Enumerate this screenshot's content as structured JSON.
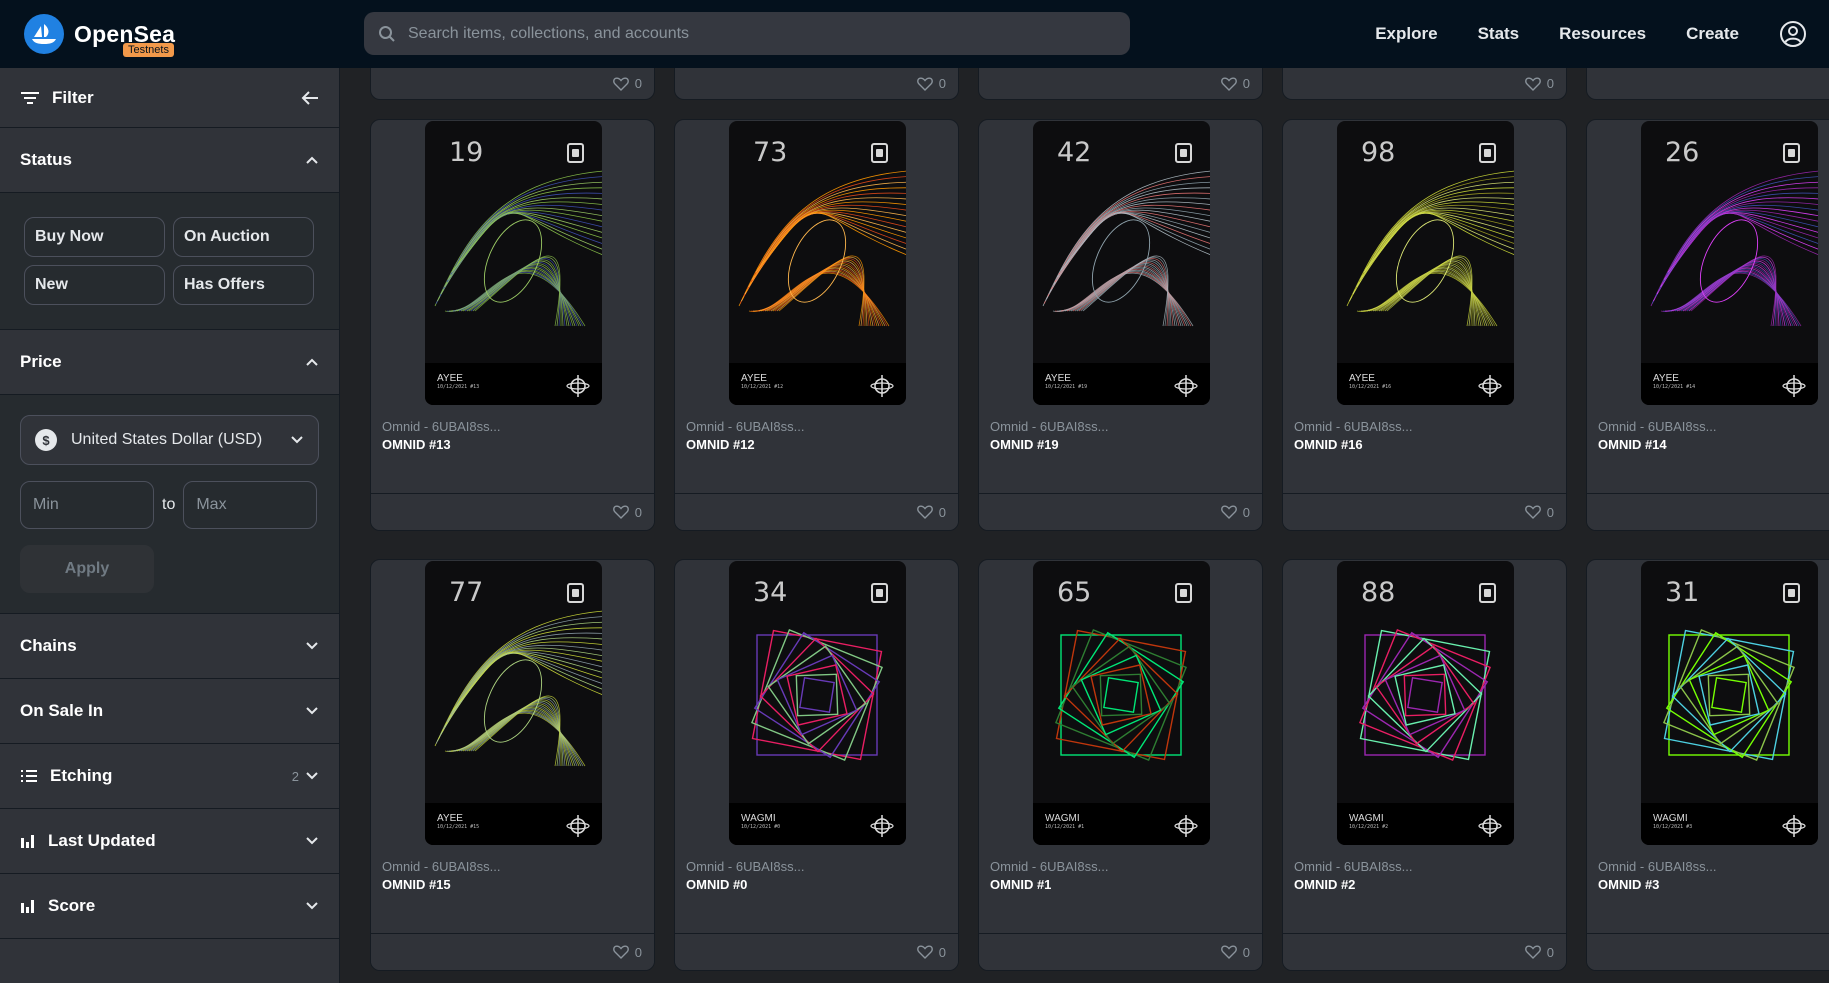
{
  "header": {
    "brand": "OpenSea",
    "env_badge": "Testnets",
    "search_placeholder": "Search items, collections, and accounts",
    "nav": [
      "Explore",
      "Stats",
      "Resources",
      "Create"
    ]
  },
  "sidebar": {
    "filter_label": "Filter",
    "status": {
      "title": "Status",
      "options": [
        "Buy Now",
        "On Auction",
        "New",
        "Has Offers"
      ]
    },
    "price": {
      "title": "Price",
      "currency": "United States Dollar (USD)",
      "currency_symbol": "$",
      "min_placeholder": "Min",
      "max_placeholder": "Max",
      "to": "to",
      "apply": "Apply"
    },
    "sections": [
      {
        "label": "Chains"
      },
      {
        "label": "On Sale In"
      },
      {
        "label": "Etching",
        "count": "2"
      },
      {
        "label": "Last Updated"
      },
      {
        "label": "Score"
      }
    ]
  },
  "top_stubs": {
    "likes": [
      "0",
      "0",
      "0",
      "0"
    ]
  },
  "items": [
    {
      "number": "19",
      "series": "AYEE",
      "date": "10/12/2021 #13",
      "collection": "Omnid - 6UBAI8ss...",
      "name": "OMNID #13",
      "likes": "0",
      "style": "wave",
      "colors": [
        "#8bc34a",
        "#3f51b5",
        "#9ccc65"
      ]
    },
    {
      "number": "73",
      "series": "AYEE",
      "date": "10/12/2021 #12",
      "collection": "Omnid - 6UBAI8ss...",
      "name": "OMNID #12",
      "likes": "0",
      "style": "wave",
      "colors": [
        "#ff9800",
        "#e64a19",
        "#ffb74d"
      ]
    },
    {
      "number": "42",
      "series": "AYEE",
      "date": "10/12/2021 #19",
      "collection": "Omnid - 6UBAI8ss...",
      "name": "OMNID #19",
      "likes": "0",
      "style": "wave",
      "colors": [
        "#b0bec5",
        "#e57373",
        "#90a4ae"
      ]
    },
    {
      "number": "98",
      "series": "AYEE",
      "date": "10/12/2021 #16",
      "collection": "Omnid - 6UBAI8ss...",
      "name": "OMNID #16",
      "likes": "0",
      "style": "wave",
      "colors": [
        "#cddc39",
        "#9e9d24",
        "#dce775"
      ]
    },
    {
      "number": "26",
      "series": "AYEE",
      "date": "10/12/2021 #14",
      "collection": "Omnid - 6UBAI8ss...",
      "name": "OMNID #14",
      "likes": "",
      "style": "wave",
      "colors": [
        "#9c27b0",
        "#3f51b5",
        "#e040fb"
      ]
    },
    {
      "number": "77",
      "series": "AYEE",
      "date": "10/12/2021 #15",
      "collection": "Omnid - 6UBAI8ss...",
      "name": "OMNID #15",
      "likes": "0",
      "style": "wave",
      "colors": [
        "#cddc39",
        "#90a4ae",
        "#aed581"
      ]
    },
    {
      "number": "34",
      "series": "WAGMI",
      "date": "10/12/2021 #0",
      "collection": "Omnid - 6UBAI8ss...",
      "name": "OMNID #0",
      "likes": "0",
      "style": "spiral",
      "colors": [
        "#673ab7",
        "#e91e63",
        "#81c784"
      ]
    },
    {
      "number": "65",
      "series": "WAGMI",
      "date": "10/12/2021 #1",
      "collection": "Omnid - 6UBAI8ss...",
      "name": "OMNID #1",
      "likes": "0",
      "style": "spiral",
      "colors": [
        "#00e676",
        "#bf360c",
        "#2e7d32"
      ]
    },
    {
      "number": "88",
      "series": "WAGMI",
      "date": "10/12/2021 #2",
      "collection": "Omnid - 6UBAI8ss...",
      "name": "OMNID #2",
      "likes": "0",
      "style": "spiral",
      "colors": [
        "#9c27b0",
        "#69f0ae",
        "#e91e63"
      ]
    },
    {
      "number": "31",
      "series": "WAGMI",
      "date": "10/12/2021 #3",
      "collection": "Omnid - 6UBAI8ss...",
      "name": "OMNID #3",
      "likes": "",
      "style": "spiral",
      "colors": [
        "#76ff03",
        "#4dd0e1",
        "#8bc34a"
      ]
    }
  ]
}
